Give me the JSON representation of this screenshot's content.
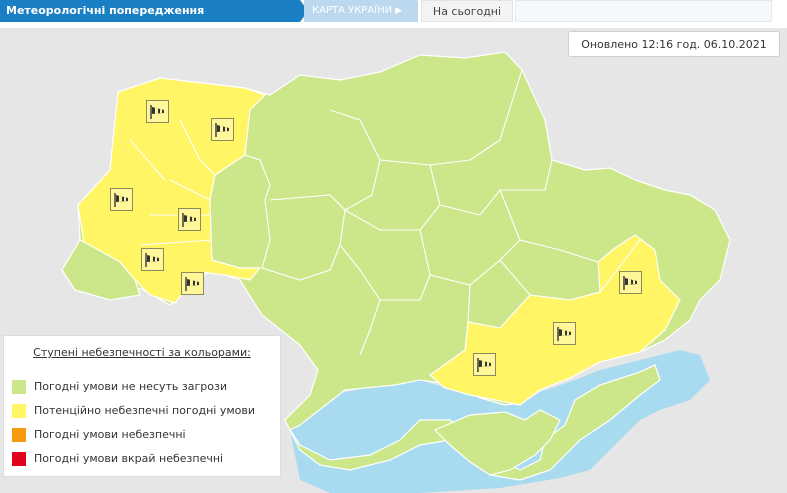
{
  "tabs": {
    "title": "Метеорологічні попередження",
    "map": "КАРТА УКРАЇНИ",
    "today": "На сьогодні"
  },
  "updated": "Оновлено 12:16 год. 06.10.2021",
  "legend": {
    "title": "Ступені небезпечності за кольорами:",
    "items": [
      {
        "label": "Погодні умови не несуть загрози",
        "color": "#cce68a"
      },
      {
        "label": "Потенційно небезпечні погодні умови",
        "color": "#fff565"
      },
      {
        "label": "Погодні умови небезпечні",
        "color": "#f79a0d"
      },
      {
        "label": "Погодні умови вкрай небезпечні",
        "color": "#e3021b"
      }
    ]
  },
  "map_colors": {
    "land_outside": "#e6e6e6",
    "sea": "#a8dbf0",
    "green": "#cce68a",
    "yellow": "#fff565",
    "border": "#ffffff"
  },
  "warning_icon": "windsock-icon"
}
